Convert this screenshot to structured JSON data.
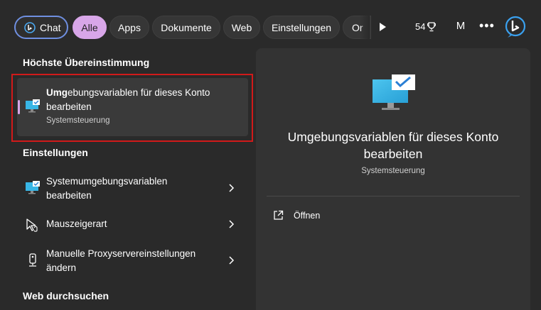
{
  "filters": {
    "chat": "Chat",
    "all": "Alle",
    "apps": "Apps",
    "documents": "Dokumente",
    "web": "Web",
    "settings": "Einstellungen",
    "more_partial": "Or"
  },
  "topbar": {
    "points": "54",
    "user_initial": "M",
    "more": "•••"
  },
  "best_match": {
    "heading": "Höchste Übereinstimmung",
    "title_bold": "Umg",
    "title_rest": "ebungsvariablen für dieses Konto",
    "title_line2": "bearbeiten",
    "subtitle": "Systemsteuerung",
    "icon": "control-panel-monitor-icon"
  },
  "settings_section": {
    "heading": "Einstellungen",
    "items": [
      {
        "line1": "Systemumgebungsvariablen",
        "line2": "bearbeiten",
        "icon": "control-panel-monitor-icon"
      },
      {
        "line1": "Mauszeigerart",
        "line2": "",
        "icon": "mouse-pointer-icon"
      },
      {
        "line1": "Manuelle Proxyservereinstellungen",
        "line2": "ändern",
        "icon": "proxy-device-icon"
      }
    ]
  },
  "web_section": {
    "heading": "Web durchsuchen"
  },
  "preview": {
    "title_line1": "Umgebungsvariablen für dieses Konto",
    "title_line2": "bearbeiten",
    "subtitle": "Systemsteuerung",
    "open_label": "Öffnen",
    "icon": "control-panel-monitor-icon"
  },
  "colors": {
    "accent": "#d8a6e8",
    "highlight_border": "#d11a1a",
    "chat_border": "#6f8fe0"
  }
}
